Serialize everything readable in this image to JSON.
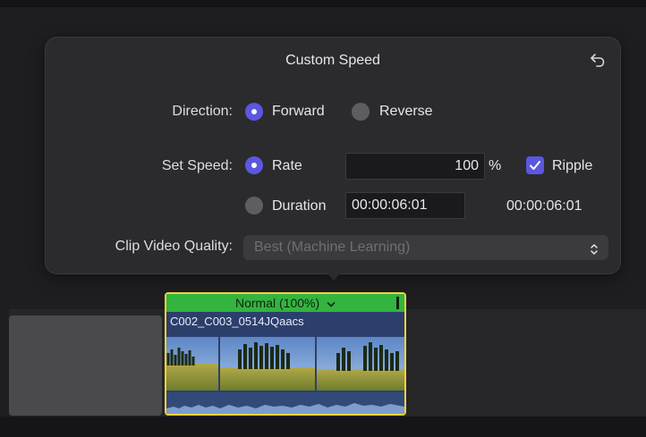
{
  "popover": {
    "title": "Custom Speed",
    "direction": {
      "label": "Direction:",
      "options": [
        "Forward",
        "Reverse"
      ],
      "selected": "Forward"
    },
    "set_speed": {
      "label": "Set Speed:",
      "rate_label": "Rate",
      "rate_value": "100",
      "rate_unit": "%",
      "ripple_label": "Ripple",
      "ripple_checked": true,
      "duration_label": "Duration",
      "duration_value": "00:00:06:01",
      "duration_readout": "00:00:06:01",
      "selected": "Rate"
    },
    "clip_video_quality": {
      "label": "Clip Video Quality:",
      "value": "Best (Machine Learning)"
    }
  },
  "timeline": {
    "clip": {
      "speed_label": "Normal (100%)",
      "name": "C002_C003_0514JQaacs"
    }
  },
  "colors": {
    "accent": "#5b57e0",
    "clip_border": "#f3d43d",
    "speed_bar": "#33b43f",
    "clip_body": "#2c3f6c"
  },
  "icons": {
    "reset": "reset-arrow-icon",
    "chevron_updown": "chevron-updown-icon",
    "dropdown": "chevron-down-icon",
    "check": "checkmark-icon"
  }
}
